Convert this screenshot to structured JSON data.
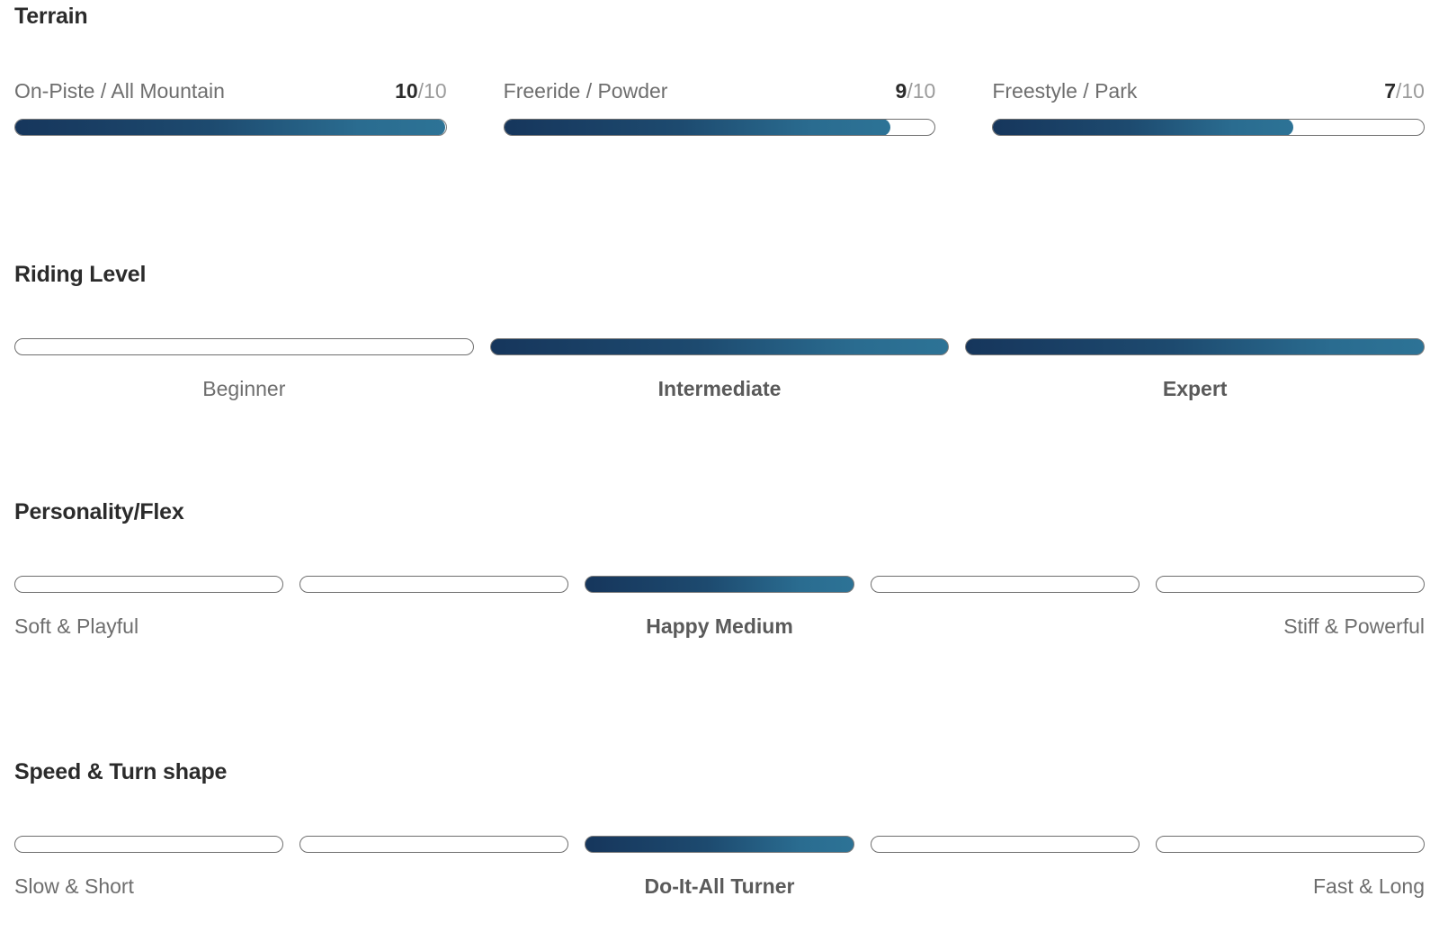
{
  "sections": {
    "terrain": {
      "title": "Terrain",
      "max": 10,
      "items": [
        {
          "label": "On-Piste / All Mountain",
          "value": 10,
          "value_text": "10",
          "max_text": "/10",
          "percent": 100
        },
        {
          "label": "Freeride / Powder",
          "value": 9,
          "value_text": "9",
          "max_text": "/10",
          "percent": 90
        },
        {
          "label": "Freestyle / Park",
          "value": 7,
          "value_text": "7",
          "max_text": "/10",
          "percent": 70
        }
      ]
    },
    "riding_level": {
      "title": "Riding Level",
      "segments": [
        {
          "label": "Beginner",
          "filled": false
        },
        {
          "label": "Intermediate",
          "filled": true
        },
        {
          "label": "Expert",
          "filled": true
        }
      ]
    },
    "personality_flex": {
      "title": "Personality/Flex",
      "segments": [
        {
          "label": "Soft & Playful",
          "filled": false,
          "align": "left"
        },
        {
          "label": "",
          "filled": false,
          "align": "center"
        },
        {
          "label": "Happy Medium",
          "filled": true,
          "align": "center"
        },
        {
          "label": "",
          "filled": false,
          "align": "center"
        },
        {
          "label": "Stiff & Powerful",
          "filled": false,
          "align": "right"
        }
      ]
    },
    "speed_turn_shape": {
      "title": "Speed & Turn shape",
      "segments": [
        {
          "label": "Slow & Short",
          "filled": false,
          "align": "left"
        },
        {
          "label": "",
          "filled": false,
          "align": "center"
        },
        {
          "label": "Do-It-All Turner",
          "filled": true,
          "align": "center"
        },
        {
          "label": "",
          "filled": false,
          "align": "center"
        },
        {
          "label": "Fast & Long",
          "filled": false,
          "align": "right"
        }
      ]
    }
  },
  "colors": {
    "gradient_start": "#16365c",
    "gradient_end": "#2d7396",
    "track_border": "#6e6e6e",
    "heading": "#2b2b2b",
    "label": "#6e6e6e",
    "label_active": "#5a5a5a",
    "score_muted": "#9b9b9b"
  }
}
